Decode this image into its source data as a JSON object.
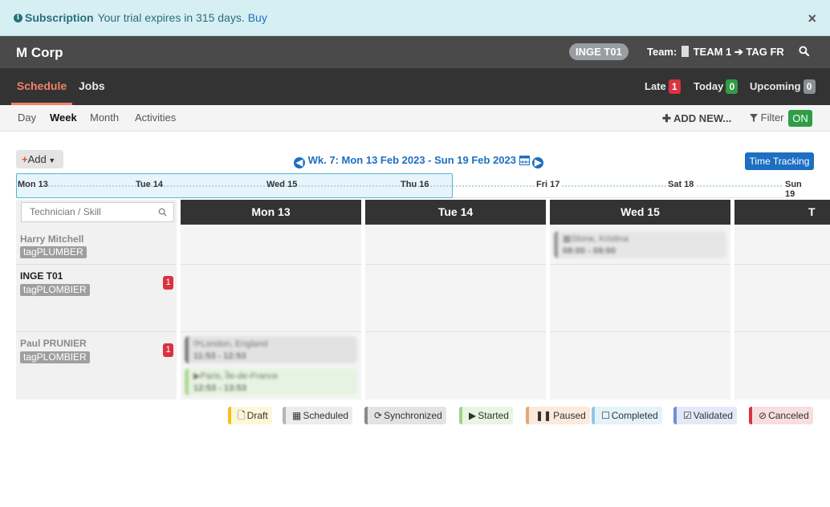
{
  "banner": {
    "title": "Subscription",
    "message": "Your trial expires in 315 days.",
    "buy_label": "Buy",
    "close_label": "×"
  },
  "header": {
    "brand": "M Corp",
    "user_badge": "INGE T01",
    "team_label": "Team:",
    "team_value": "TEAM 1 ➔ TAG FR"
  },
  "nav": {
    "tabs": [
      {
        "label": "Schedule",
        "active": true
      },
      {
        "label": "Jobs",
        "active": false
      }
    ],
    "counters": [
      {
        "label": "Late",
        "count": "1",
        "color": "#d9333f"
      },
      {
        "label": "Today",
        "count": "0",
        "color": "#2f9d45"
      },
      {
        "label": "Upcoming",
        "count": "0",
        "color": "#8a8f94"
      }
    ]
  },
  "subnav": {
    "views": [
      "Day",
      "Week",
      "Month",
      "Activities"
    ],
    "active_view": "Week",
    "add_new_label": "ADD NEW...",
    "filter_label": "Filter",
    "filter_state": "ON"
  },
  "toolbar": {
    "add_label": "Add",
    "week_label": "Wk. 7: Mon 13 Feb 2023 - Sun 19 Feb 2023",
    "time_tracking_label": "Time Tracking"
  },
  "timeline": {
    "days": [
      "Mon 13",
      "Tue 14",
      "Wed 15",
      "Thu 16",
      "Fri 17",
      "Sat 18",
      "Sun 19"
    ]
  },
  "technicians": {
    "search_placeholder": "Technician / Skill",
    "rows": [
      {
        "name": "Harry Mitchell",
        "tag": "tagPLUMBER",
        "badge": ""
      },
      {
        "name": "INGE T01",
        "tag": "tagPLOMBIER",
        "badge": "1"
      },
      {
        "name": "Paul PRUNIER",
        "tag": "tagPLOMBIER",
        "badge": "1"
      }
    ]
  },
  "day_columns": [
    "Mon 13",
    "Tue 14",
    "Wed 15",
    "T"
  ],
  "events": [
    {
      "location": "Stone, Kristina",
      "time": "08:00 - 09:00",
      "status": "scheduled"
    },
    {
      "location": "London, England",
      "time": "11:53 - 12:53",
      "status": "synchronized"
    },
    {
      "location": "Paris, Île-de-France",
      "time": "12:53 - 13:53",
      "status": "started"
    }
  ],
  "legend": [
    {
      "label": "Draft",
      "icon": "file-icon",
      "color": "#f2c318",
      "bg": "#fdf6d9"
    },
    {
      "label": "Scheduled",
      "icon": "calendar-icon",
      "color": "#b5b5b5",
      "bg": "#ececec"
    },
    {
      "label": "Synchronized",
      "icon": "refresh-icon",
      "color": "#8a8a8a",
      "bg": "#e3e3e3"
    },
    {
      "label": "Started",
      "icon": "play-icon",
      "color": "#9fd38b",
      "bg": "#e8f5e2"
    },
    {
      "label": "Paused",
      "icon": "pause-icon",
      "color": "#e3a876",
      "bg": "#fbe9db"
    },
    {
      "label": "Completed",
      "icon": "square-icon",
      "color": "#8ec8e5",
      "bg": "#e4f2f9"
    },
    {
      "label": "Validated",
      "icon": "check-square-icon",
      "color": "#6f8fd6",
      "bg": "#e3e9f7"
    },
    {
      "label": "Canceled",
      "icon": "ban-icon",
      "color": "#d9333f",
      "bg": "#f8dede"
    }
  ]
}
